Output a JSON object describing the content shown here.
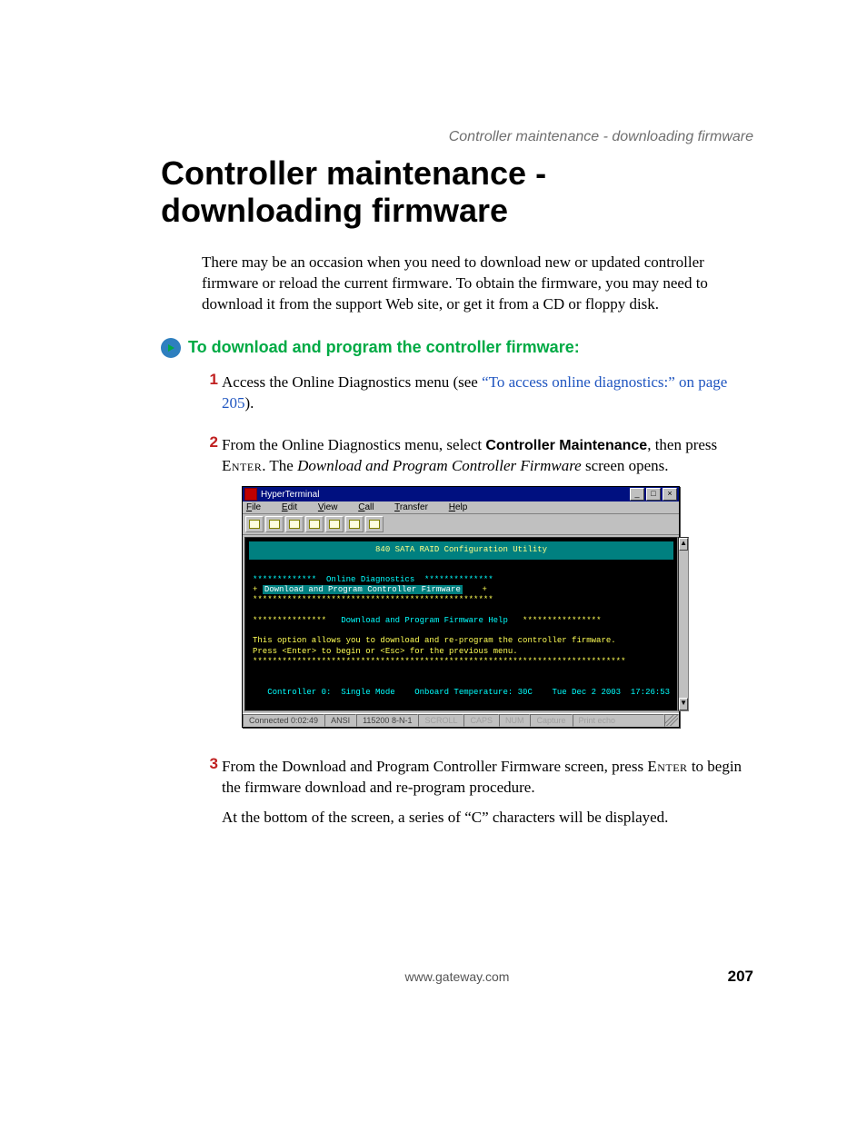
{
  "running_header": "Controller maintenance - downloading firmware",
  "title": "Controller maintenance - downloading firmware",
  "intro": "There may be an occasion when you need to download new or updated controller firmware or reload the current firmware. To obtain the firmware, you may need to download it from the support Web site, or get it from a CD or floppy disk.",
  "procedure_heading": "To download and program the controller firmware:",
  "steps": {
    "s1_pre": "Access the Online Diagnostics menu (see ",
    "s1_xref": "“To access online diagnostics:” on page 205",
    "s1_post": ").",
    "s2_pre": "From the Online Diagnostics menu, select ",
    "s2_ui": "Controller Maintenance",
    "s2_mid": ", then press ",
    "s2_key": "Enter",
    "s2_post1": ". The ",
    "s2_ital": "Download and Program Controller Firmware",
    "s2_post2": " screen opens.",
    "s3_pre": "From the Download and Program Controller Firmware screen, press ",
    "s3_key": "Enter",
    "s3_post": " to begin the firmware download and re-program procedure.",
    "s3_p2": "At the bottom of the screen, a series of “C” characters will be displayed."
  },
  "hyperterminal": {
    "title": "HyperTerminal",
    "menus": [
      "File",
      "Edit",
      "View",
      "Call",
      "Transfer",
      "Help"
    ],
    "window_buttons": [
      "_",
      "□",
      "×"
    ],
    "scroll_buttons": [
      "▲",
      "▼"
    ],
    "banner": "840 SATA RAID Configuration Utility",
    "section_line": "*************  Online Diagnostics  **************",
    "menu_item_pre": "+ ",
    "menu_item": "Download and Program Controller Firmware",
    "menu_item_post": "    +",
    "divider": "*************************************************",
    "help_title_pre": "***************   ",
    "help_title": "Download and Program Firmware Help",
    "help_title_post": "   ****************",
    "help_line1": "This option allows you to download and re-program the controller firmware.",
    "help_line2": "Press <Enter> to begin or <Esc> for the previous menu.",
    "help_divider": "****************************************************************************",
    "status_line": "   Controller 0:  Single Mode    Onboard Temperature: 30C    Tue Dec 2 2003  17:26:53",
    "statusbar": {
      "connected": "Connected 0:02:49",
      "emulation": "ANSI",
      "settings": "115200 8-N-1",
      "cells": [
        "SCROLL",
        "CAPS",
        "NUM",
        "Capture",
        "Print echo"
      ]
    }
  },
  "footer": {
    "url": "www.gateway.com",
    "page": "207"
  }
}
